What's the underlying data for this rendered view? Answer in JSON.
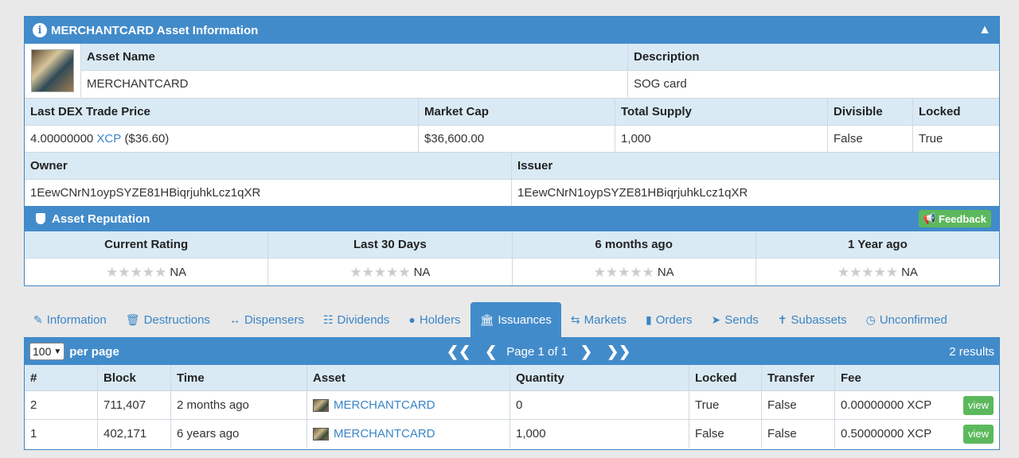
{
  "asset_panel": {
    "title": "MERCHANTCARD Asset Information",
    "labels": {
      "asset_name": "Asset Name",
      "description": "Description",
      "last_dex_price": "Last DEX Trade Price",
      "market_cap": "Market Cap",
      "total_supply": "Total Supply",
      "divisible": "Divisible",
      "locked": "Locked",
      "owner": "Owner",
      "issuer": "Issuer"
    },
    "values": {
      "asset_name": "MERCHANTCARD",
      "description": "SOG card",
      "last_dex_price_amount": "4.00000000",
      "last_dex_price_unit": "XCP",
      "last_dex_price_usd": "($36.60)",
      "market_cap": "$36,600.00",
      "total_supply": "1,000",
      "divisible": "False",
      "locked": "True",
      "owner": "1EewCNrN1oypSYZE81HBiqrjuhkLcz1qXR",
      "issuer": "1EewCNrN1oypSYZE81HBiqrjuhkLcz1qXR"
    }
  },
  "reputation": {
    "title": "Asset Reputation",
    "feedback_label": "Feedback",
    "columns": [
      {
        "label": "Current Rating",
        "value": "NA"
      },
      {
        "label": "Last 30 Days",
        "value": "NA"
      },
      {
        "label": "6 months ago",
        "value": "NA"
      },
      {
        "label": "1 Year ago",
        "value": "NA"
      }
    ]
  },
  "tabs": [
    {
      "label": "Information",
      "icon": "pencil-icon"
    },
    {
      "label": "Destructions",
      "icon": "trash-icon"
    },
    {
      "label": "Dispensers",
      "icon": "arrows-h-icon"
    },
    {
      "label": "Dividends",
      "icon": "sitemap-icon"
    },
    {
      "label": "Holders",
      "icon": "user-icon"
    },
    {
      "label": "Issuances",
      "icon": "bank-icon",
      "active": true
    },
    {
      "label": "Markets",
      "icon": "exchange-icon"
    },
    {
      "label": "Orders",
      "icon": "book-icon"
    },
    {
      "label": "Sends",
      "icon": "paper-plane-icon"
    },
    {
      "label": "Subassets",
      "icon": "child-icon"
    },
    {
      "label": "Unconfirmed",
      "icon": "clock-icon"
    }
  ],
  "issuances": {
    "per_page_value": "100",
    "per_page_label": "per page",
    "page_text": "Page 1 of 1",
    "results": "2 results",
    "headers": [
      "#",
      "Block",
      "Time",
      "Asset",
      "Quantity",
      "Locked",
      "Transfer",
      "Fee"
    ],
    "view_label": "view",
    "rows": [
      {
        "num": "2",
        "block": "711,407",
        "time": "2 months ago",
        "asset": "MERCHANTCARD",
        "quantity": "0",
        "locked": "True",
        "transfer": "False",
        "fee": "0.00000000 XCP"
      },
      {
        "num": "1",
        "block": "402,171",
        "time": "6 years ago",
        "asset": "MERCHANTCARD",
        "quantity": "1,000",
        "locked": "False",
        "transfer": "False",
        "fee": "0.50000000 XCP"
      }
    ]
  },
  "colors": {
    "header_blue": "#428bca",
    "label_bg": "#d9eaf5",
    "link": "#3a85c6",
    "green": "#5cb85c"
  }
}
